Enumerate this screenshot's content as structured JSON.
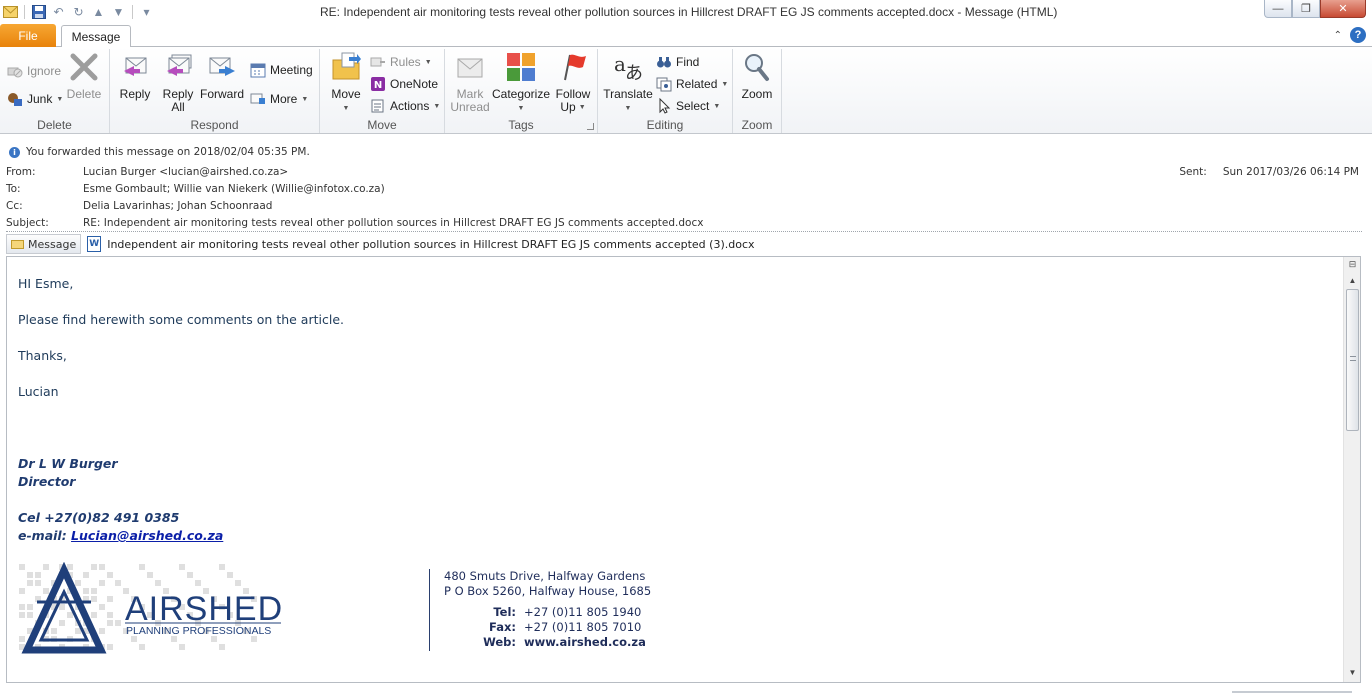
{
  "window": {
    "title": "RE: Independent air monitoring tests reveal other pollution sources in Hillcrest DRAFT EG JS comments accepted.docx  -  Message (HTML)",
    "minimize_glyph": "—",
    "restore_glyph": "❐",
    "close_glyph": "✕"
  },
  "tabs": {
    "file": "File",
    "message": "Message"
  },
  "ribbon": {
    "delete_group": {
      "label": "Delete",
      "ignore": "Ignore",
      "junk": "Junk",
      "delete": "Delete"
    },
    "respond_group": {
      "label": "Respond",
      "reply": "Reply",
      "reply_all_1": "Reply",
      "reply_all_2": "All",
      "forward": "Forward",
      "meeting": "Meeting",
      "more": "More"
    },
    "move_group": {
      "label": "Move",
      "move": "Move",
      "rules": "Rules",
      "onenote": "OneNote",
      "actions": "Actions"
    },
    "tags_group": {
      "label": "Tags",
      "mark_unread_1": "Mark",
      "mark_unread_2": "Unread",
      "categorize": "Categorize",
      "follow_up_1": "Follow",
      "follow_up_2": "Up"
    },
    "editing_group": {
      "label": "Editing",
      "translate": "Translate",
      "find": "Find",
      "related": "Related",
      "select": "Select"
    },
    "zoom_group": {
      "label": "Zoom",
      "zoom": "Zoom"
    }
  },
  "header": {
    "info": "You forwarded this message on 2018/02/04 05:35 PM.",
    "from_label": "From:",
    "from": "Lucian Burger <lucian@airshed.co.za>",
    "to_label": "To:",
    "to": "Esme Gombault; Willie van Niekerk (Willie@infotox.co.za)",
    "cc_label": "Cc:",
    "cc": "Delia Lavarinhas; Johan Schoonraad",
    "subject_label": "Subject:",
    "subject": "RE: Independent air monitoring tests reveal other pollution sources in Hillcrest DRAFT EG JS comments accepted.docx",
    "sent_label": "Sent:",
    "sent": "Sun 2017/03/26 06:14 PM",
    "message_tab": "Message",
    "attachment": "Independent air monitoring tests reveal other pollution sources in Hillcrest DRAFT EG JS comments accepted (3).docx"
  },
  "body": {
    "greeting": "HI Esme,",
    "line1": "Please find herewith some comments on the article.",
    "thanks": "Thanks,",
    "name": "Lucian",
    "sig_name": "Dr L W Burger",
    "sig_title": "Director",
    "sig_cel": "Cel +27(0)82 491 0385",
    "sig_email_label": "e-mail: ",
    "sig_email": "Lucian@airshed.co.za",
    "logo_word": "AIRSHED",
    "logo_sub": "PLANNING PROFESSIONALS",
    "addr1": "480 Smuts Drive, Halfway Gardens",
    "addr2": "P O Box 5260, Halfway House, 1685",
    "tel_label": "Tel:",
    "tel": "+27 (0)11 805 1940",
    "fax_label": "Fax:",
    "fax": "+27 (0)11 805 7010",
    "web_label": "Web:",
    "web": "www.airshed.co.za"
  },
  "colors": {
    "file_tab": "#f39a1e",
    "accent_blue": "#2a5fa8",
    "logo_navy": "#1f3f7a"
  }
}
